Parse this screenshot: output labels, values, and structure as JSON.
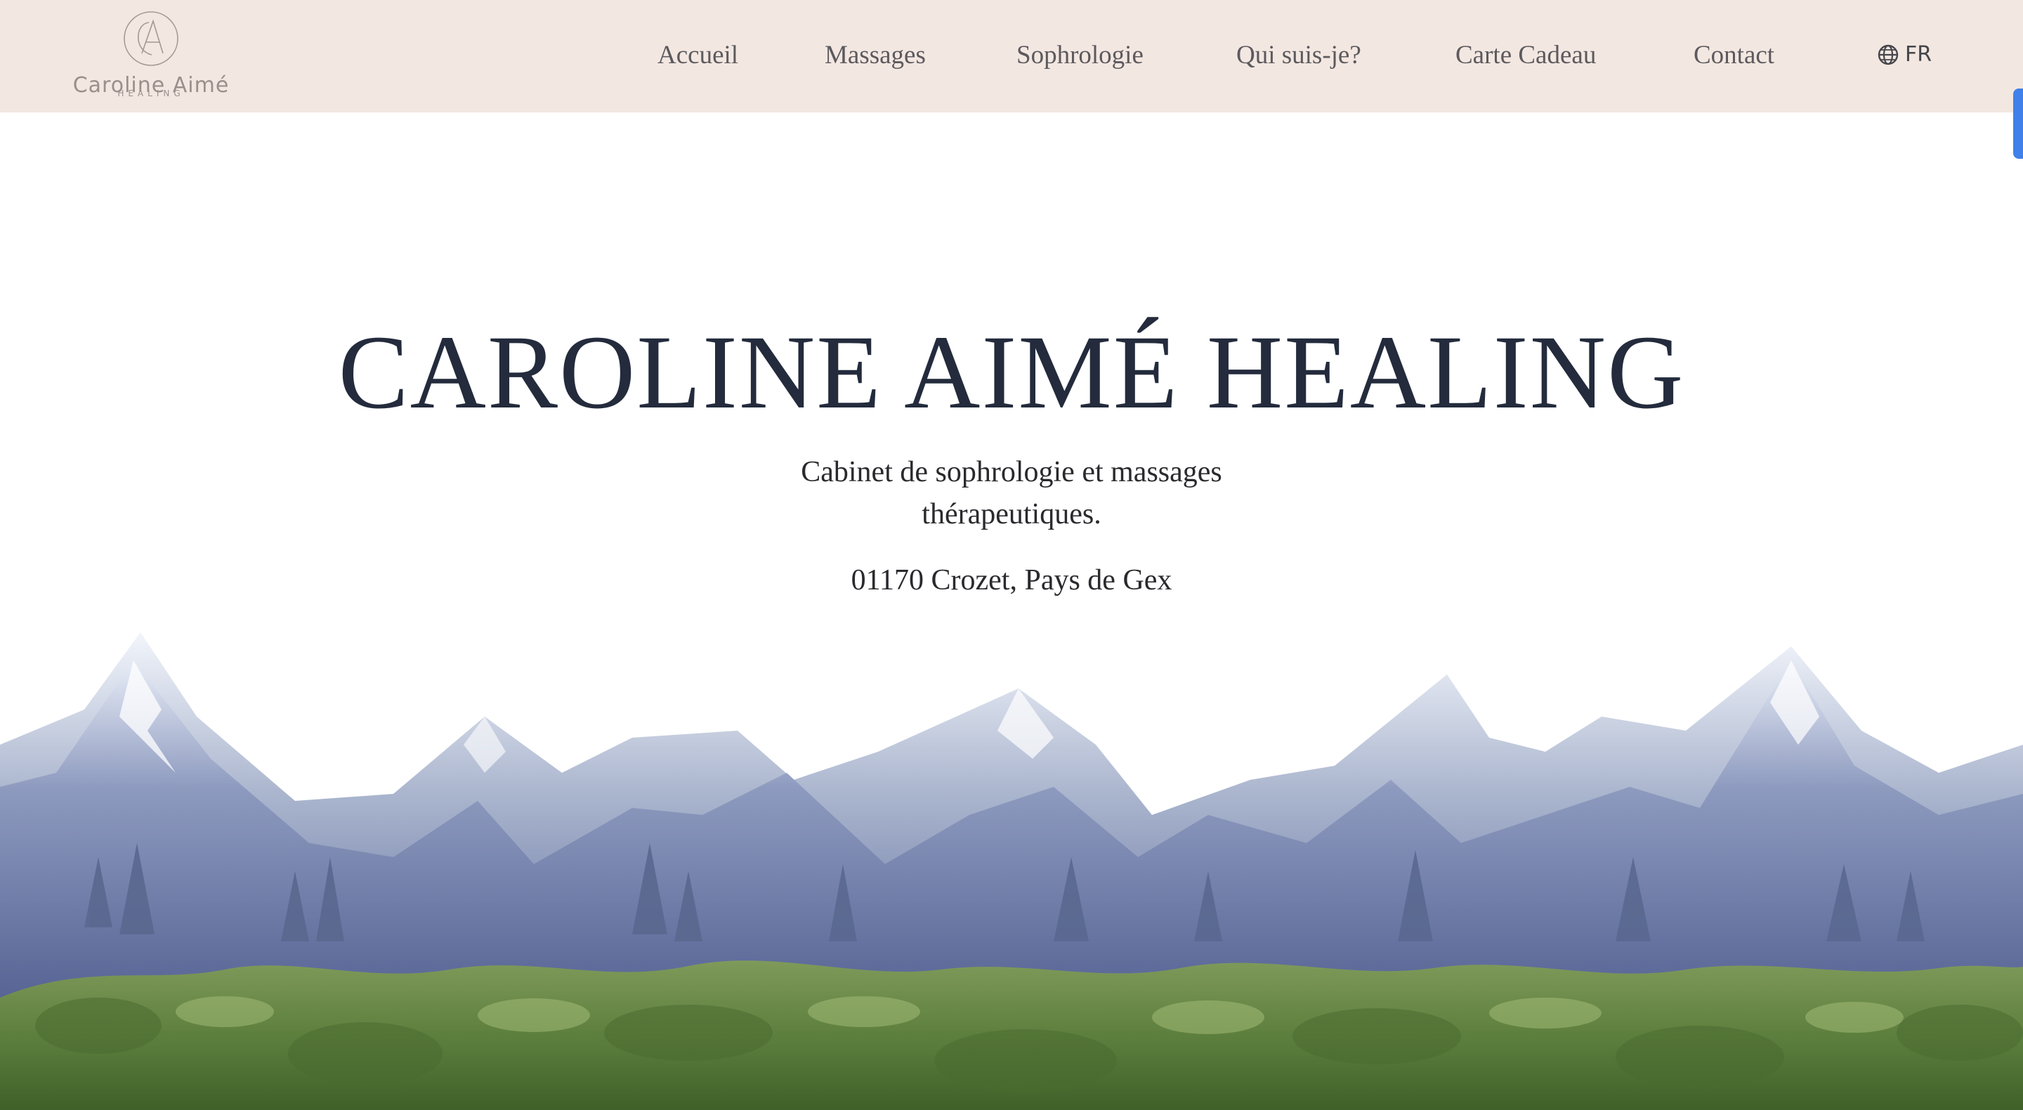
{
  "logo": {
    "monogram": "CA",
    "name": "Caroline Aimé",
    "tagline": "HEALING"
  },
  "nav": {
    "items": [
      {
        "label": "Accueil"
      },
      {
        "label": "Massages"
      },
      {
        "label": "Sophrologie"
      },
      {
        "label": "Qui suis-je?"
      },
      {
        "label": "Carte Cadeau"
      },
      {
        "label": "Contact"
      }
    ],
    "language": {
      "icon": "globe-icon",
      "label": "FR"
    }
  },
  "hero": {
    "title": "CAROLINE AIMÉ HEALING",
    "subtitle": "Cabinet de sophrologie et massages thérapeutiques.",
    "location": "01170 Crozet, Pays de Gex"
  },
  "colors": {
    "header_bg": "#f3e7e1",
    "title": "#232b3c",
    "nav_text": "#5c5a5e",
    "accent_tab": "#3f80ea"
  }
}
